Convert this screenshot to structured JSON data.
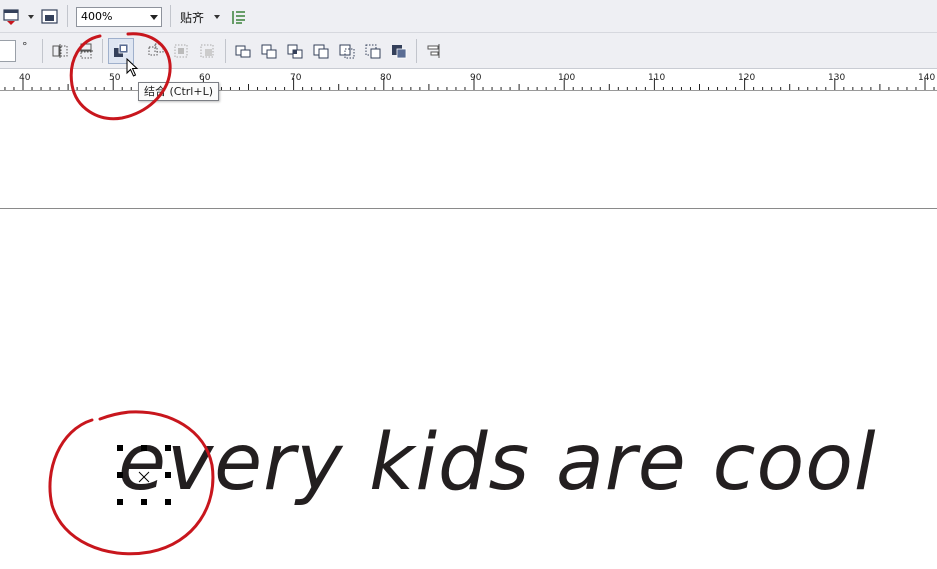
{
  "toolbar": {
    "zoom_value": "400%",
    "snap_label": "贴齐",
    "angle_unit": "°"
  },
  "ruler": {
    "labels": [
      "40",
      "50",
      "60",
      "70",
      "80",
      "90",
      "100",
      "110",
      "120",
      "130",
      "140"
    ]
  },
  "tooltip": {
    "text": "结合 (Ctrl+L)"
  },
  "canvas": {
    "text": "every kids are cool"
  },
  "colors": {
    "annotation_red": "#c8161d",
    "toolbar_bg": "#eeeff3",
    "text_color": "#231f20"
  },
  "icons": {
    "toolbar1": [
      "page-setup-icon",
      "dropdown-icon",
      "view-mode-icon",
      "snap-options-icon"
    ],
    "toolbar2": [
      "mirror-horizontal-icon",
      "mirror-vertical-icon",
      "combine-icon",
      "break-apart-icon",
      "group-icon",
      "ungroup-icon",
      "weld-icon",
      "trim-icon",
      "intersect-icon",
      "simplify-icon",
      "front-minus-back-icon",
      "back-minus-front-icon",
      "boundary-icon",
      "align-icon"
    ]
  }
}
